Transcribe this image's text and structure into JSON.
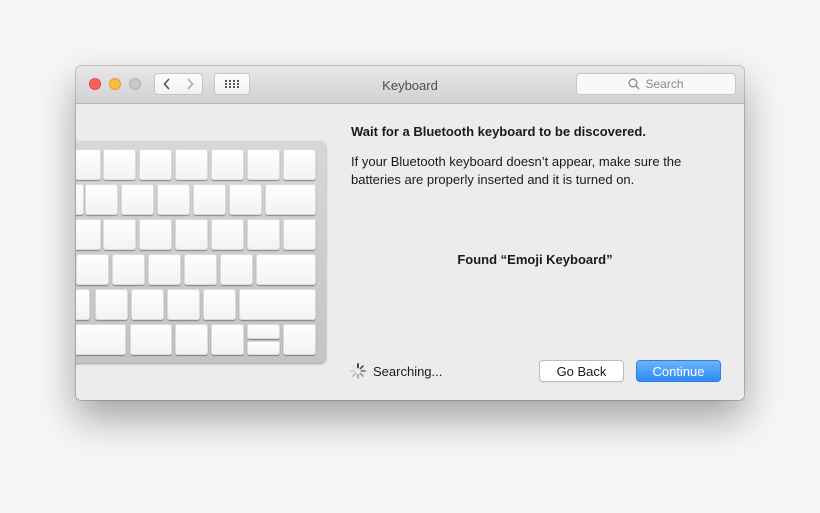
{
  "window": {
    "title": "Keyboard"
  },
  "toolbar": {
    "search_placeholder": "Search"
  },
  "content": {
    "heading": "Wait for a Bluetooth keyboard to be discovered.",
    "description": "If your Bluetooth keyboard doesn’t appear, make sure the batteries are properly inserted and it is turned on.",
    "found_text": "Found “Emoji Keyboard”",
    "status_text": "Searching..."
  },
  "buttons": {
    "go_back": "Go Back",
    "continue": "Continue"
  },
  "icons": [
    "back-chevron-icon",
    "forward-chevron-icon",
    "grid-icon",
    "search-icon",
    "spinner-icon"
  ],
  "colors": {
    "accent": "#3a8ef6",
    "close": "#fc605c",
    "minimize": "#fdbc40"
  }
}
